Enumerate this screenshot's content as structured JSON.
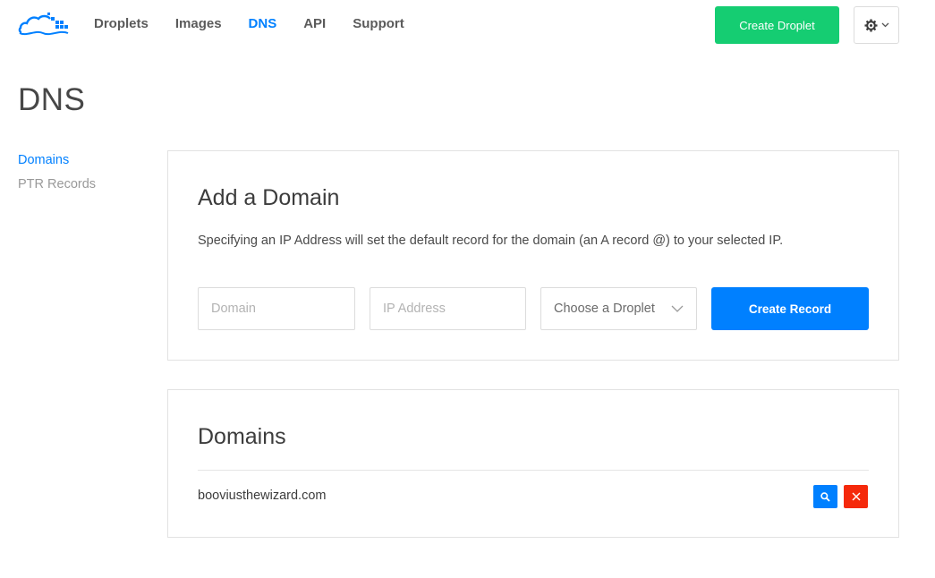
{
  "nav": {
    "items": [
      {
        "label": "Droplets",
        "active": false
      },
      {
        "label": "Images",
        "active": false
      },
      {
        "label": "DNS",
        "active": true
      },
      {
        "label": "API",
        "active": false
      },
      {
        "label": "Support",
        "active": false
      }
    ],
    "create_droplet_label": "Create Droplet",
    "settings_icon": "gear-icon"
  },
  "page": {
    "title": "DNS"
  },
  "sidebar": {
    "items": [
      {
        "label": "Domains",
        "active": true
      },
      {
        "label": "PTR Records",
        "active": false
      }
    ]
  },
  "add_domain": {
    "heading": "Add a Domain",
    "description": "Specifying an IP Address will set the default record for the domain (an A record @) to your selected IP.",
    "domain_placeholder": "Domain",
    "domain_value": "",
    "ip_placeholder": "IP Address",
    "ip_value": "",
    "droplet_select_label": "Choose a Droplet",
    "create_record_label": "Create Record"
  },
  "domains": {
    "heading": "Domains",
    "rows": [
      {
        "name": "booviusthewizard.com"
      }
    ]
  },
  "colors": {
    "accent": "#0080ff",
    "create_green": "#15cd72",
    "delete_red": "#f5290b"
  }
}
